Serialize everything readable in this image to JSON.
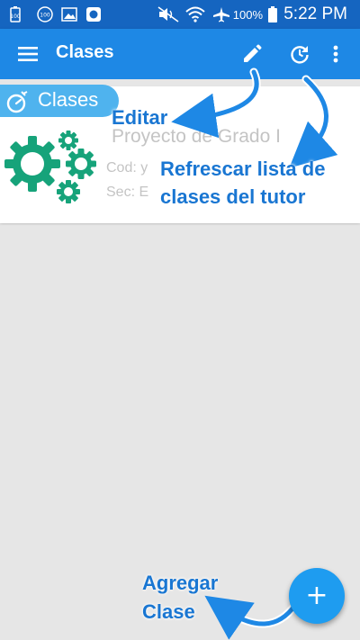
{
  "status_bar": {
    "notification_icons": [
      "battery-saver-icon",
      "data-saver-icon",
      "gallery-icon",
      "camera-icon"
    ],
    "system_icons": [
      "mute-icon",
      "wifi-icon",
      "airplane-icon",
      "battery-icon"
    ],
    "battery": "100%",
    "time": "5:22 PM"
  },
  "toolbar": {
    "title": "Clases",
    "actions": [
      "menu-icon",
      "edit-icon",
      "refresh-icon",
      "overflow-menu-icon"
    ]
  },
  "card": {
    "tag": "Clases",
    "title": "Proyecto de Grado I",
    "cod": "Cod: y",
    "sec": "Sec: E"
  },
  "annotations": {
    "edit": "Editar",
    "refresh_line1": "Refrescar lista de",
    "refresh_line2": "clases del tutor",
    "add_line1": "Agregar",
    "add_line2": "Clase"
  },
  "fab": {
    "label": "+"
  },
  "colors": {
    "status_bar": "#1565c0",
    "app_bar": "#1e88e5",
    "fab": "#1e9cf0",
    "gear": "#16a37a",
    "annotation": "#1976d2"
  }
}
